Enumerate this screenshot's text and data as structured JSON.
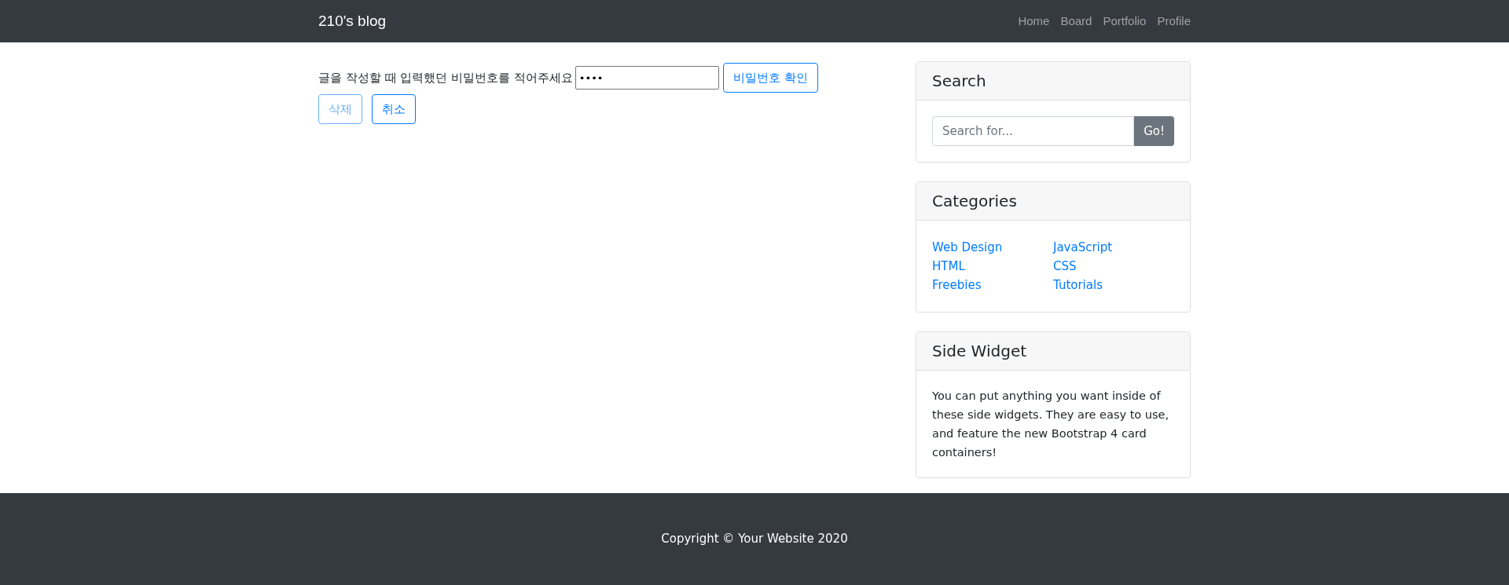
{
  "navbar": {
    "brand": "210's blog",
    "links": [
      {
        "label": "Home"
      },
      {
        "label": "Board"
      },
      {
        "label": "Portfolio"
      },
      {
        "label": "Profile"
      }
    ]
  },
  "password_form": {
    "label": "글을 작성할 때 입력했던 비밀번호를 적어주세요",
    "value": "••••",
    "confirm_button": "비밀번호 확인"
  },
  "actions": [
    {
      "label": "삭제",
      "disabled": true
    },
    {
      "label": "취소",
      "disabled": false
    }
  ],
  "search_card": {
    "title": "Search",
    "placeholder": "Search for...",
    "button": "Go!"
  },
  "categories_card": {
    "title": "Categories",
    "columns": [
      [
        "Web Design",
        "HTML",
        "Freebies"
      ],
      [
        "JavaScript",
        "CSS",
        "Tutorials"
      ]
    ]
  },
  "side_widget": {
    "title": "Side Widget",
    "text": "You can put anything you want inside of these side widgets. They are easy to use, and feature the new Bootstrap 4 card containers!"
  },
  "footer": {
    "text": "Copyright © Your Website 2020"
  }
}
